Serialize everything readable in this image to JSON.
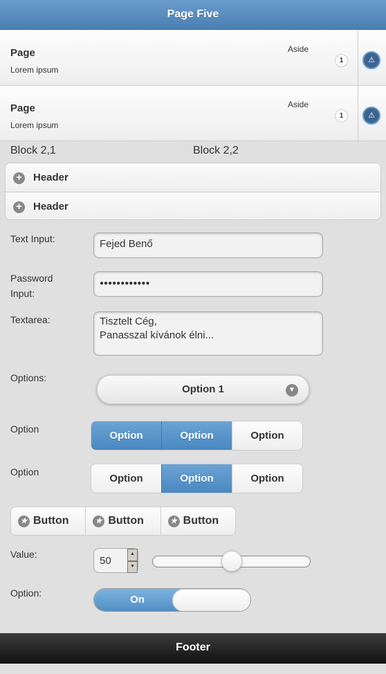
{
  "header": {
    "title": "Page Five"
  },
  "list": [
    {
      "title": "Page",
      "subtitle": "Lorem ipsum",
      "aside": "Aside",
      "count": "1",
      "icon": "alert-icon"
    },
    {
      "title": "Page",
      "subtitle": "Lorem ipsum",
      "aside": "Aside",
      "count": "1",
      "icon": "alert-icon"
    }
  ],
  "grid": {
    "b21": "Block 2,1",
    "b22": "Block 2,2"
  },
  "collapsibles": [
    "Header",
    "Header"
  ],
  "form": {
    "text_label": "Text Input:",
    "text_value": "Fejed Benő",
    "password_label": "Password Input:",
    "password_value": "●●●●●●●●●●●●",
    "textarea_label": "Textarea:",
    "textarea_value": "Tisztelt Cég,\nPanasszal kívánok élni...",
    "options_label": "Options:",
    "select_value": "Option 1",
    "group1_label": "Option",
    "group1": [
      "Option",
      "Option",
      "Option"
    ],
    "group1_selected": [
      0,
      1
    ],
    "group2_label": "Option",
    "group2": [
      "Option",
      "Option",
      "Option"
    ],
    "group2_selected": [
      1
    ],
    "buttons": [
      "Button",
      "Button",
      "Button"
    ],
    "value_label": "Value:",
    "value": "50",
    "slider": {
      "value": 50,
      "min": 0,
      "max": 100
    },
    "flip_label": "Option:",
    "flip_on": "On",
    "flip_state": "on"
  },
  "footer": {
    "title": "Footer"
  },
  "colors": {
    "accent": "#4a88c0",
    "footer": "#1e1e1e"
  }
}
